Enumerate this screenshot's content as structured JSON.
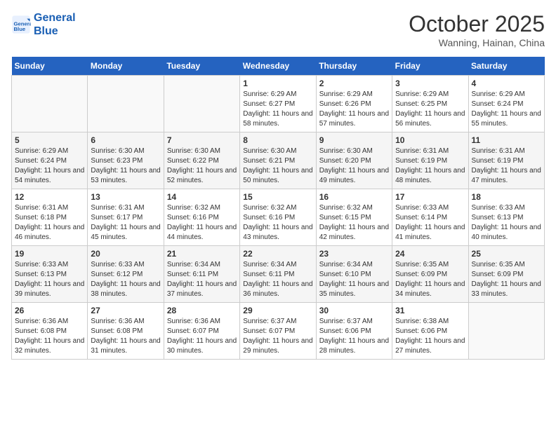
{
  "logo": {
    "line1": "General",
    "line2": "Blue"
  },
  "title": "October 2025",
  "subtitle": "Wanning, Hainan, China",
  "weekdays": [
    "Sunday",
    "Monday",
    "Tuesday",
    "Wednesday",
    "Thursday",
    "Friday",
    "Saturday"
  ],
  "weeks": [
    [
      {
        "day": "",
        "sunrise": "",
        "sunset": "",
        "daylight": ""
      },
      {
        "day": "",
        "sunrise": "",
        "sunset": "",
        "daylight": ""
      },
      {
        "day": "",
        "sunrise": "",
        "sunset": "",
        "daylight": ""
      },
      {
        "day": "1",
        "sunrise": "Sunrise: 6:29 AM",
        "sunset": "Sunset: 6:27 PM",
        "daylight": "Daylight: 11 hours and 58 minutes."
      },
      {
        "day": "2",
        "sunrise": "Sunrise: 6:29 AM",
        "sunset": "Sunset: 6:26 PM",
        "daylight": "Daylight: 11 hours and 57 minutes."
      },
      {
        "day": "3",
        "sunrise": "Sunrise: 6:29 AM",
        "sunset": "Sunset: 6:25 PM",
        "daylight": "Daylight: 11 hours and 56 minutes."
      },
      {
        "day": "4",
        "sunrise": "Sunrise: 6:29 AM",
        "sunset": "Sunset: 6:24 PM",
        "daylight": "Daylight: 11 hours and 55 minutes."
      }
    ],
    [
      {
        "day": "5",
        "sunrise": "Sunrise: 6:29 AM",
        "sunset": "Sunset: 6:24 PM",
        "daylight": "Daylight: 11 hours and 54 minutes."
      },
      {
        "day": "6",
        "sunrise": "Sunrise: 6:30 AM",
        "sunset": "Sunset: 6:23 PM",
        "daylight": "Daylight: 11 hours and 53 minutes."
      },
      {
        "day": "7",
        "sunrise": "Sunrise: 6:30 AM",
        "sunset": "Sunset: 6:22 PM",
        "daylight": "Daylight: 11 hours and 52 minutes."
      },
      {
        "day": "8",
        "sunrise": "Sunrise: 6:30 AM",
        "sunset": "Sunset: 6:21 PM",
        "daylight": "Daylight: 11 hours and 50 minutes."
      },
      {
        "day": "9",
        "sunrise": "Sunrise: 6:30 AM",
        "sunset": "Sunset: 6:20 PM",
        "daylight": "Daylight: 11 hours and 49 minutes."
      },
      {
        "day": "10",
        "sunrise": "Sunrise: 6:31 AM",
        "sunset": "Sunset: 6:19 PM",
        "daylight": "Daylight: 11 hours and 48 minutes."
      },
      {
        "day": "11",
        "sunrise": "Sunrise: 6:31 AM",
        "sunset": "Sunset: 6:19 PM",
        "daylight": "Daylight: 11 hours and 47 minutes."
      }
    ],
    [
      {
        "day": "12",
        "sunrise": "Sunrise: 6:31 AM",
        "sunset": "Sunset: 6:18 PM",
        "daylight": "Daylight: 11 hours and 46 minutes."
      },
      {
        "day": "13",
        "sunrise": "Sunrise: 6:31 AM",
        "sunset": "Sunset: 6:17 PM",
        "daylight": "Daylight: 11 hours and 45 minutes."
      },
      {
        "day": "14",
        "sunrise": "Sunrise: 6:32 AM",
        "sunset": "Sunset: 6:16 PM",
        "daylight": "Daylight: 11 hours and 44 minutes."
      },
      {
        "day": "15",
        "sunrise": "Sunrise: 6:32 AM",
        "sunset": "Sunset: 6:16 PM",
        "daylight": "Daylight: 11 hours and 43 minutes."
      },
      {
        "day": "16",
        "sunrise": "Sunrise: 6:32 AM",
        "sunset": "Sunset: 6:15 PM",
        "daylight": "Daylight: 11 hours and 42 minutes."
      },
      {
        "day": "17",
        "sunrise": "Sunrise: 6:33 AM",
        "sunset": "Sunset: 6:14 PM",
        "daylight": "Daylight: 11 hours and 41 minutes."
      },
      {
        "day": "18",
        "sunrise": "Sunrise: 6:33 AM",
        "sunset": "Sunset: 6:13 PM",
        "daylight": "Daylight: 11 hours and 40 minutes."
      }
    ],
    [
      {
        "day": "19",
        "sunrise": "Sunrise: 6:33 AM",
        "sunset": "Sunset: 6:13 PM",
        "daylight": "Daylight: 11 hours and 39 minutes."
      },
      {
        "day": "20",
        "sunrise": "Sunrise: 6:33 AM",
        "sunset": "Sunset: 6:12 PM",
        "daylight": "Daylight: 11 hours and 38 minutes."
      },
      {
        "day": "21",
        "sunrise": "Sunrise: 6:34 AM",
        "sunset": "Sunset: 6:11 PM",
        "daylight": "Daylight: 11 hours and 37 minutes."
      },
      {
        "day": "22",
        "sunrise": "Sunrise: 6:34 AM",
        "sunset": "Sunset: 6:11 PM",
        "daylight": "Daylight: 11 hours and 36 minutes."
      },
      {
        "day": "23",
        "sunrise": "Sunrise: 6:34 AM",
        "sunset": "Sunset: 6:10 PM",
        "daylight": "Daylight: 11 hours and 35 minutes."
      },
      {
        "day": "24",
        "sunrise": "Sunrise: 6:35 AM",
        "sunset": "Sunset: 6:09 PM",
        "daylight": "Daylight: 11 hours and 34 minutes."
      },
      {
        "day": "25",
        "sunrise": "Sunrise: 6:35 AM",
        "sunset": "Sunset: 6:09 PM",
        "daylight": "Daylight: 11 hours and 33 minutes."
      }
    ],
    [
      {
        "day": "26",
        "sunrise": "Sunrise: 6:36 AM",
        "sunset": "Sunset: 6:08 PM",
        "daylight": "Daylight: 11 hours and 32 minutes."
      },
      {
        "day": "27",
        "sunrise": "Sunrise: 6:36 AM",
        "sunset": "Sunset: 6:08 PM",
        "daylight": "Daylight: 11 hours and 31 minutes."
      },
      {
        "day": "28",
        "sunrise": "Sunrise: 6:36 AM",
        "sunset": "Sunset: 6:07 PM",
        "daylight": "Daylight: 11 hours and 30 minutes."
      },
      {
        "day": "29",
        "sunrise": "Sunrise: 6:37 AM",
        "sunset": "Sunset: 6:07 PM",
        "daylight": "Daylight: 11 hours and 29 minutes."
      },
      {
        "day": "30",
        "sunrise": "Sunrise: 6:37 AM",
        "sunset": "Sunset: 6:06 PM",
        "daylight": "Daylight: 11 hours and 28 minutes."
      },
      {
        "day": "31",
        "sunrise": "Sunrise: 6:38 AM",
        "sunset": "Sunset: 6:06 PM",
        "daylight": "Daylight: 11 hours and 27 minutes."
      },
      {
        "day": "",
        "sunrise": "",
        "sunset": "",
        "daylight": ""
      }
    ]
  ]
}
